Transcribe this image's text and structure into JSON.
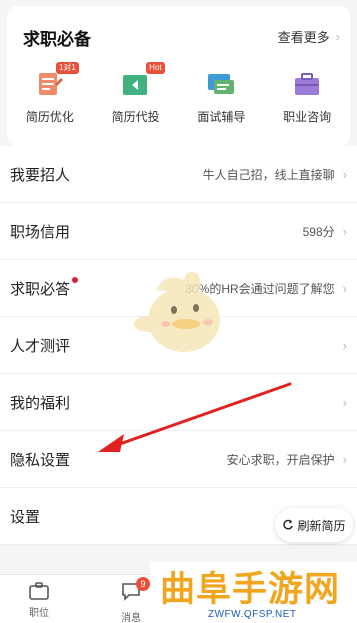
{
  "card": {
    "title": "求职必备",
    "more_label": "查看更多",
    "items": [
      {
        "label": "简历优化",
        "badge": "1对1",
        "icon": "resume-optimize-icon"
      },
      {
        "label": "简历代投",
        "badge": "Hot",
        "icon": "resume-delivery-icon"
      },
      {
        "label": "面试辅导",
        "badge": "",
        "icon": "interview-coaching-icon"
      },
      {
        "label": "职业咨询",
        "badge": "",
        "icon": "career-consulting-icon"
      }
    ]
  },
  "list": {
    "recruit": {
      "label": "我要招人",
      "value": "牛人自己招，线上直接聊"
    },
    "credit": {
      "label": "职场信用",
      "value": "598分"
    },
    "guide": {
      "label": "求职必答",
      "value": "80%的HR会通过问题了解您"
    },
    "assessment": {
      "label": "人才测评",
      "value": ""
    },
    "welfare": {
      "label": "我的福利",
      "value": ""
    },
    "privacy": {
      "label": "隐私设置",
      "value": "安心求职，开启保护"
    },
    "settings": {
      "label": "设置",
      "value": ""
    }
  },
  "refresh": {
    "label": "刷新简历"
  },
  "bottom_nav": {
    "jobs": {
      "label": "职位"
    },
    "messages": {
      "label": "消息",
      "badge": "9"
    }
  },
  "watermark": {
    "title": "曲阜手游网",
    "url": "ZWFW.QFSP.NET"
  },
  "colors": {
    "accent_red": "#e8503a",
    "watermark_orange": "#f2a51e",
    "watermark_blue": "#1a5fb4"
  }
}
